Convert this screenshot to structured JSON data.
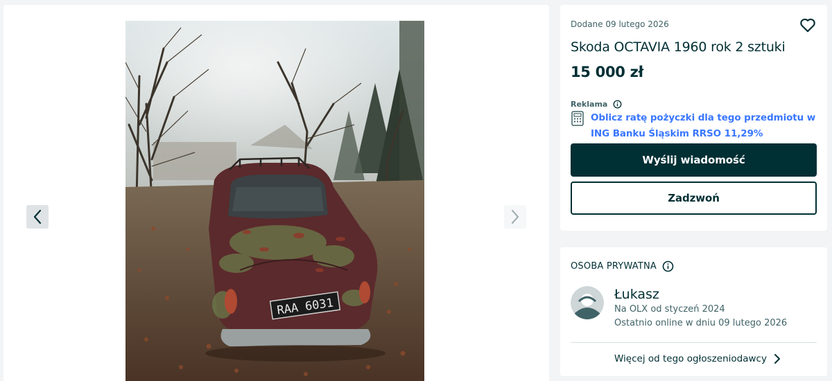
{
  "listing": {
    "posted": "Dodane 09 lutego 2026",
    "title": "Skoda OCTAVIA 1960 rok 2 sztuki",
    "price": "15 000 zł",
    "plate": "RAA 6031"
  },
  "ad": {
    "label": "Reklama",
    "link_text": "Oblicz ratę pożyczki dla tego przedmiotu w ING Banku Śląskim RRSO 11,29%"
  },
  "buttons": {
    "message": "Wyślij wiadomość",
    "call": "Zadzwoń"
  },
  "seller": {
    "type": "OSOBA PRYWATNA",
    "name": "Łukasz",
    "since": "Na OLX od styczeń 2024",
    "last_online": "Ostatnio online w dniu 09 lutego 2026",
    "more_link": "Więcej od tego ogłoszeniodawcy"
  },
  "icons": {
    "favorite": "heart-icon",
    "info": "info-icon",
    "calculator": "calculator-icon",
    "prev": "chevron-left-icon",
    "next": "chevron-right-icon",
    "more": "chevron-right-icon"
  },
  "colors": {
    "primary": "#002f34",
    "ad_link": "#3a77ff",
    "muted": "#406367",
    "background": "#f2f4f5"
  }
}
